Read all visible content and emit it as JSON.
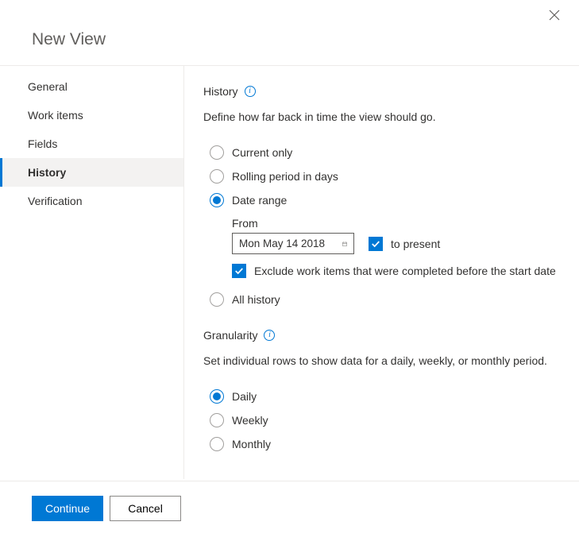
{
  "title": "New View",
  "sidebar": {
    "items": [
      {
        "label": "General"
      },
      {
        "label": "Work items"
      },
      {
        "label": "Fields"
      },
      {
        "label": "History"
      },
      {
        "label": "Verification"
      }
    ],
    "selectedIndex": 3
  },
  "history": {
    "heading": "History",
    "description": "Define how far back in time the view should go.",
    "options": {
      "currentOnly": "Current only",
      "rollingPeriod": "Rolling period in days",
      "dateRange": "Date range",
      "allHistory": "All history"
    },
    "selected": "dateRange",
    "dateRange": {
      "fromLabel": "From",
      "fromValue": "Mon May 14 2018",
      "toPresentLabel": "to present",
      "toPresentChecked": true,
      "excludeLabel": "Exclude work items that were completed before the start date",
      "excludeChecked": true
    }
  },
  "granularity": {
    "heading": "Granularity",
    "description": "Set individual rows to show data for a daily, weekly, or monthly period.",
    "options": {
      "daily": "Daily",
      "weekly": "Weekly",
      "monthly": "Monthly"
    },
    "selected": "daily"
  },
  "footer": {
    "continue": "Continue",
    "cancel": "Cancel"
  }
}
